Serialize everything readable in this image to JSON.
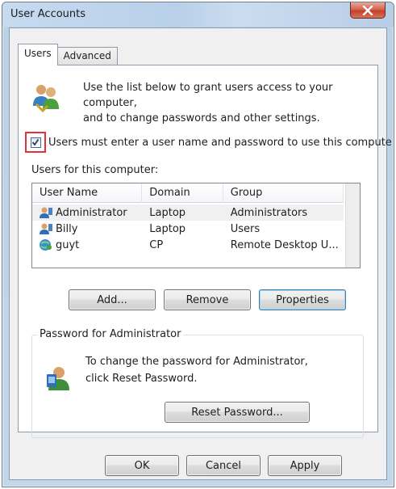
{
  "window": {
    "title": "User Accounts"
  },
  "tabs": [
    {
      "label": "Users",
      "active": true
    },
    {
      "label": "Advanced",
      "active": false
    }
  ],
  "intro": {
    "text": "Use the list below to grant users access to your computer,\nand to change passwords and other settings."
  },
  "must_login": {
    "label": "Users must enter a user name and password to use this compute",
    "checked": true
  },
  "users_label": "Users for this computer:",
  "users_table": {
    "columns": [
      "User Name",
      "Domain",
      "Group"
    ],
    "rows": [
      {
        "name": "Administrator",
        "domain": "Laptop",
        "group": "Administrators",
        "icon": "user-icon"
      },
      {
        "name": "Billy",
        "domain": "Laptop",
        "group": "Users",
        "icon": "user-icon"
      },
      {
        "name": "guyt",
        "domain": "CP",
        "group": "Remote Desktop U...",
        "icon": "network-user-icon"
      }
    ]
  },
  "buttons": {
    "add": "Add...",
    "remove": "Remove",
    "properties": "Properties",
    "reset_password": "Reset Password...",
    "ok": "OK",
    "cancel": "Cancel",
    "apply": "Apply"
  },
  "password_group": {
    "legend": "Password for Administrator",
    "text": "To change the password for Administrator,\nclick Reset Password."
  }
}
